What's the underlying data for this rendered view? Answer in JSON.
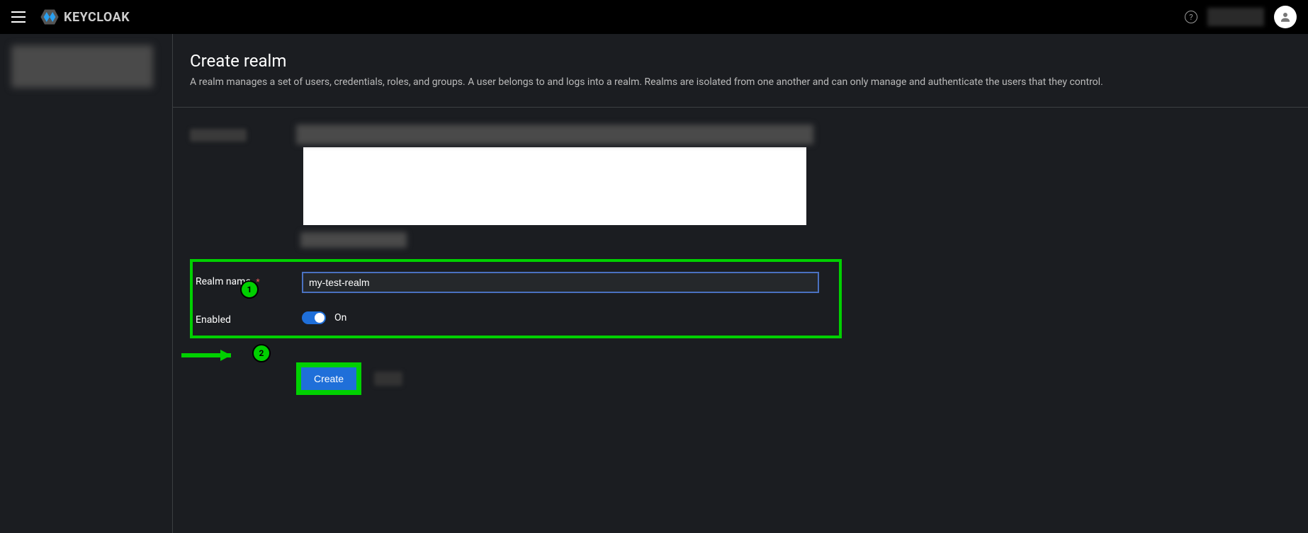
{
  "brand": "KEYCLOAK",
  "page": {
    "title": "Create realm",
    "description": "A realm manages a set of users, credentials, roles, and groups. A user belongs to and logs into a realm. Realms are isolated from one another and can only manage and authenticate the users that they control."
  },
  "form": {
    "realm_name_label": "Realm name",
    "realm_name_value": "my-test-realm",
    "enabled_label": "Enabled",
    "enabled_state": "On"
  },
  "actions": {
    "create_label": "Create"
  },
  "annotations": {
    "step1": "1",
    "step2": "2"
  }
}
